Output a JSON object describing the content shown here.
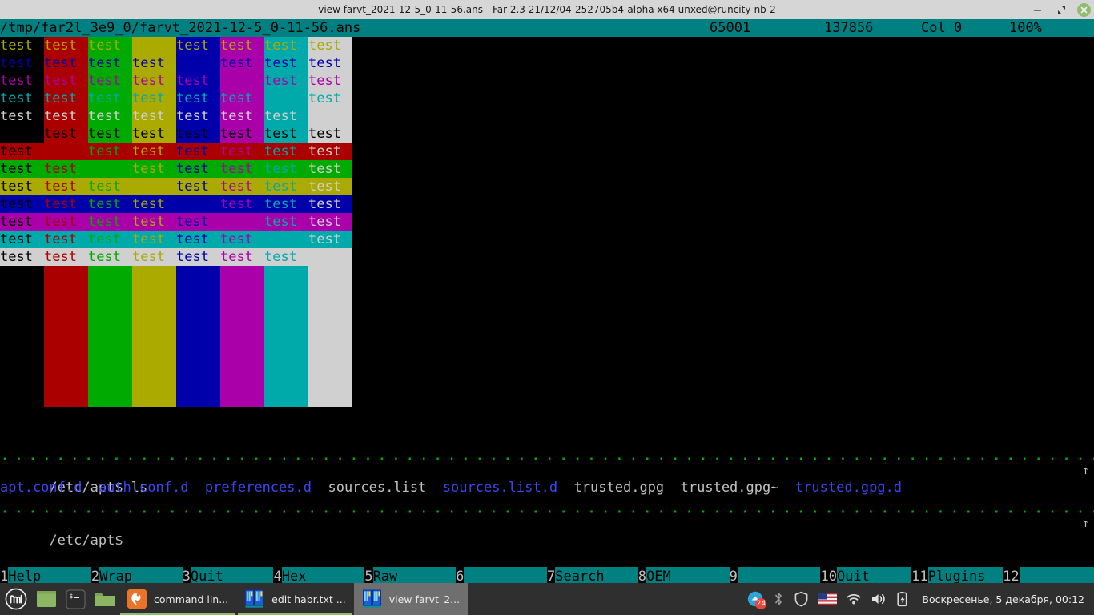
{
  "window": {
    "title": "view farvt_2021-12-5_0-11-56.ans - Far 2.3 21/12/04-252705b4-alpha x64 unxed@runcity-nb-2",
    "controls": {
      "minimize": "minimize-icon",
      "restore": "restore-icon",
      "close": "close-icon"
    }
  },
  "viewer": {
    "status": {
      "filepath": "/tmp/far2l_3e9_0/farvt_2021-12-5_0-11-56.ans",
      "codepage": "65001",
      "filesize": "137856",
      "column": "Col 0",
      "percent": "100%"
    },
    "cell_text": "test",
    "palette": {
      "black": "#000000",
      "red": "#aa0000",
      "green": "#00aa00",
      "yellow": "#aaaa00",
      "blue": "#0000aa",
      "magenta": "#aa00aa",
      "cyan": "#00aaaa",
      "white": "#d0d0d0",
      "bright_black": "#555555",
      "bright_red": "#ff5555",
      "bright_green": "#55ff55",
      "bright_yellow": "#ffff55",
      "bright_blue": "#5555ff",
      "bright_magenta": "#ff55ff",
      "bright_cyan": "#55ffff",
      "bright_white": "#ffffff"
    },
    "grid": {
      "bg_order": [
        "black",
        "red",
        "green",
        "yellow",
        "blue",
        "magenta",
        "cyan",
        "white"
      ],
      "section_a": {
        "note": "foreground varies per row, background varies per column",
        "fg_rows": [
          "yellow",
          "blue",
          "magenta",
          "cyan",
          "white",
          "black"
        ]
      },
      "section_b": {
        "note": "background varies per row, foreground varies per column",
        "bg_rows": [
          "red",
          "green",
          "yellow",
          "blue",
          "magenta",
          "cyan",
          "white"
        ],
        "fg_cols": [
          "black",
          "red",
          "green",
          "yellow",
          "blue",
          "magenta",
          "cyan",
          "white"
        ]
      },
      "section_c": {
        "note": "foreground equals background, text invisible",
        "rows": 8
      }
    },
    "console": {
      "prompt_line": "/etc/apt$ ls",
      "listing": [
        {
          "name": "apt.conf.d",
          "color": "blue"
        },
        {
          "name": "auth.conf.d",
          "color": "blue"
        },
        {
          "name": "preferences.d",
          "color": "blue"
        },
        {
          "name": "sources.list",
          "color": "white"
        },
        {
          "name": "sources.list.d",
          "color": "blue"
        },
        {
          "name": "trusted.gpg",
          "color": "white"
        },
        {
          "name": "trusted.gpg~",
          "color": "white"
        },
        {
          "name": "trusted.gpg.d",
          "color": "blue"
        }
      ],
      "prompt_empty": "/etc/apt$",
      "scroll_arrow": "↑"
    }
  },
  "keybar": [
    {
      "num": "1",
      "label": "Help    "
    },
    {
      "num": "2",
      "label": "Wrap    "
    },
    {
      "num": "3",
      "label": "Quit    "
    },
    {
      "num": "4",
      "label": "Hex     "
    },
    {
      "num": "5",
      "label": "Raw     "
    },
    {
      "num": "6",
      "label": "        "
    },
    {
      "num": "7",
      "label": "Search  "
    },
    {
      "num": "8",
      "label": "OEM     "
    },
    {
      "num": "9",
      "label": "        "
    },
    {
      "num": "10",
      "label": "Quit    "
    },
    {
      "num": "11",
      "label": "Plugins "
    },
    {
      "num": "12",
      "label": "        "
    }
  ],
  "taskbar": {
    "menu_icon": "mint-menu-icon",
    "quicklaunch": [
      {
        "icon": "show-desktop-icon",
        "name": "show-desktop"
      },
      {
        "icon": "terminal-icon",
        "name": "terminal"
      },
      {
        "icon": "files-icon",
        "name": "file-manager"
      }
    ],
    "windows": [
      {
        "icon": "firefox-icon",
        "label": "command lin...",
        "active": false
      },
      {
        "icon": "far-manager-icon",
        "label": "edit habr.txt ...",
        "active": false
      },
      {
        "icon": "far-manager-icon",
        "label": "view farvt_2...",
        "active": true
      }
    ],
    "tray": [
      {
        "name": "update-manager-icon",
        "badge": "24"
      },
      {
        "name": "bluetooth-icon"
      },
      {
        "name": "shield-icon"
      },
      {
        "name": "keyboard-layout-flag-icon",
        "label": "US"
      },
      {
        "name": "wifi-icon"
      },
      {
        "name": "volume-icon"
      },
      {
        "name": "battery-charging-icon"
      }
    ],
    "clock": "Воскресенье, 5 декабря, 00:12"
  }
}
